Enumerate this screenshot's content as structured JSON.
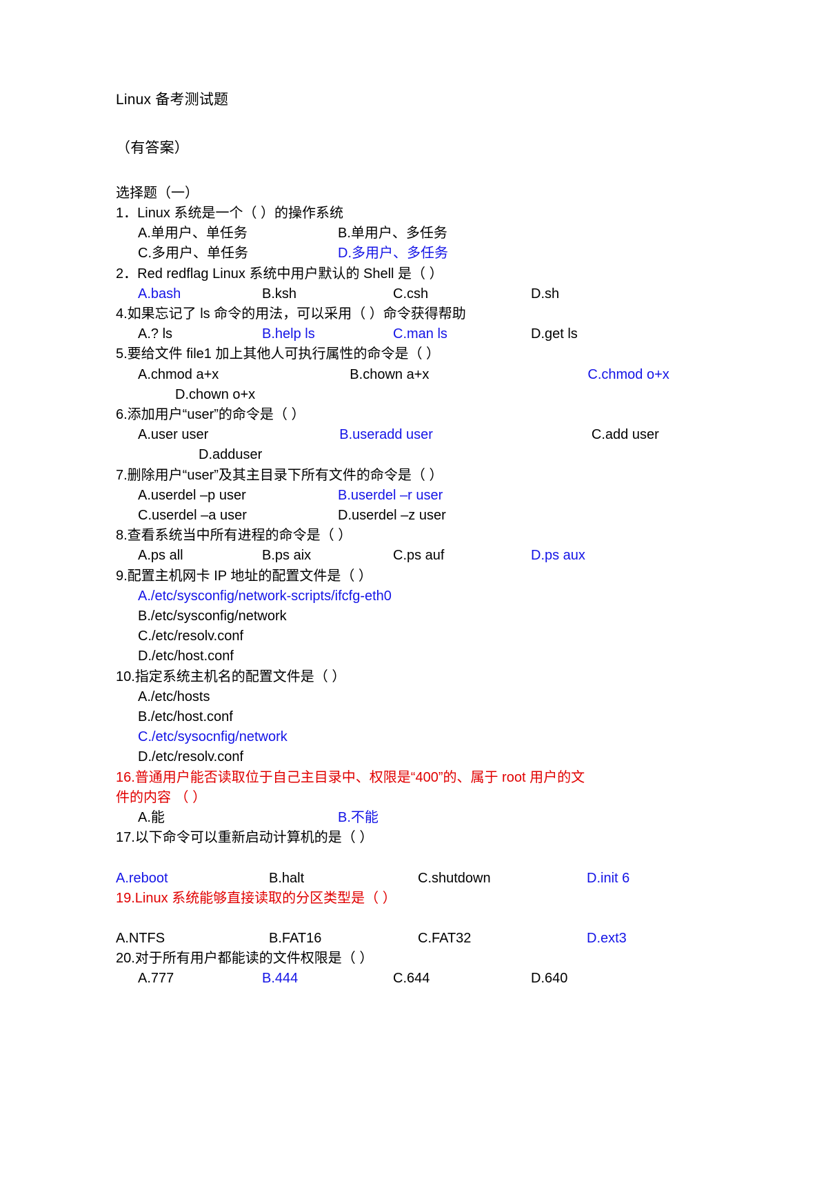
{
  "document": {
    "title": "Linux 备考测试题",
    "subtitle": "（有答案）",
    "section_label": "选择题（一）"
  },
  "questions": {
    "q1": {
      "stem": "1．Linux 系统是一个（     ）的操作系统",
      "a": "A.单用户、单任务",
      "b": "B.单用户、多任务",
      "c": "C.多用户、单任务",
      "d": "D.多用户、多任务"
    },
    "q2": {
      "stem": "2．Red redflag Linux 系统中用户默认的 Shell 是（     ）",
      "a": "A.bash",
      "b": "B.ksh",
      "c": "C.csh",
      "d": "D.sh"
    },
    "q4": {
      "stem": "4.如果忘记了 ls 命令的用法，可以采用（     ）命令获得帮助",
      "a": "A.? ls",
      "b": "B.help ls",
      "c": "C.man ls",
      "d": "D.get ls"
    },
    "q5": {
      "stem": "5.要给文件 file1 加上其他人可执行属性的命令是（     ）",
      "a": "A.chmod  a+x",
      "b": "B.chown  a+x",
      "c": "C.chmod o+x",
      "d": "D.chown o+x"
    },
    "q6": {
      "stem": "6.添加用户“user”的命令是（     ）",
      "a": "A.user   user",
      "b": "B.useradd   user",
      "c": "C.add user",
      "d": "D.adduser"
    },
    "q7": {
      "stem": "7.删除用户“user”及其主目录下所有文件的命令是（     ）",
      "a": "A.userdel –p user",
      "b": "B.userdel –r user",
      "c": "C.userdel –a user",
      "d": "D.userdel –z user"
    },
    "q8": {
      "stem": "8.查看系统当中所有进程的命令是（     ）",
      "a": "A.ps all",
      "b": "B.ps aix",
      "c": "C.ps auf",
      "d": "D.ps aux"
    },
    "q9": {
      "stem": "9.配置主机网卡 IP 地址的配置文件是（     ）",
      "a": "A./etc/sysconfig/network-scripts/ifcfg-eth0",
      "b": "B./etc/sysconfig/network",
      "c": "C./etc/resolv.conf",
      "d": "D./etc/host.conf"
    },
    "q10": {
      "stem": "10.指定系统主机名的配置文件是（     ）",
      "a": "A./etc/hosts",
      "b": "B./etc/host.conf",
      "c": "C./etc/sysocnfig/network",
      "d": "D./etc/resolv.conf"
    },
    "q16": {
      "stem_line1": "16.普通用户能否读取位于自己主目录中、权限是“400”的、属于 root 用户的文",
      "stem_line2": "件的内容      （     ）",
      "a": "A.能",
      "b": "B.不能"
    },
    "q17": {
      "stem": "17.以下命令可以重新启动计算机的是（     ）",
      "a": "A.reboot",
      "b": "B.halt",
      "c": "C.shutdown",
      "d": "D.init 6"
    },
    "q19": {
      "stem": "19.Linux 系统能够直接读取的分区类型是（     ）",
      "a": "A.NTFS",
      "b": "B.FAT16",
      "c": "C.FAT32",
      "d": "D.ext3"
    },
    "q20": {
      "stem": "20.对于所有用户都能读的文件权限是（     ）",
      "a": "A.777",
      "b": "B.444",
      "c": "C.644",
      "d": "D.640"
    }
  },
  "colors": {
    "answer_blue": "#1414e6",
    "highlight_red": "#e00000",
    "body_black": "#000000",
    "page_background": "#ffffff"
  }
}
